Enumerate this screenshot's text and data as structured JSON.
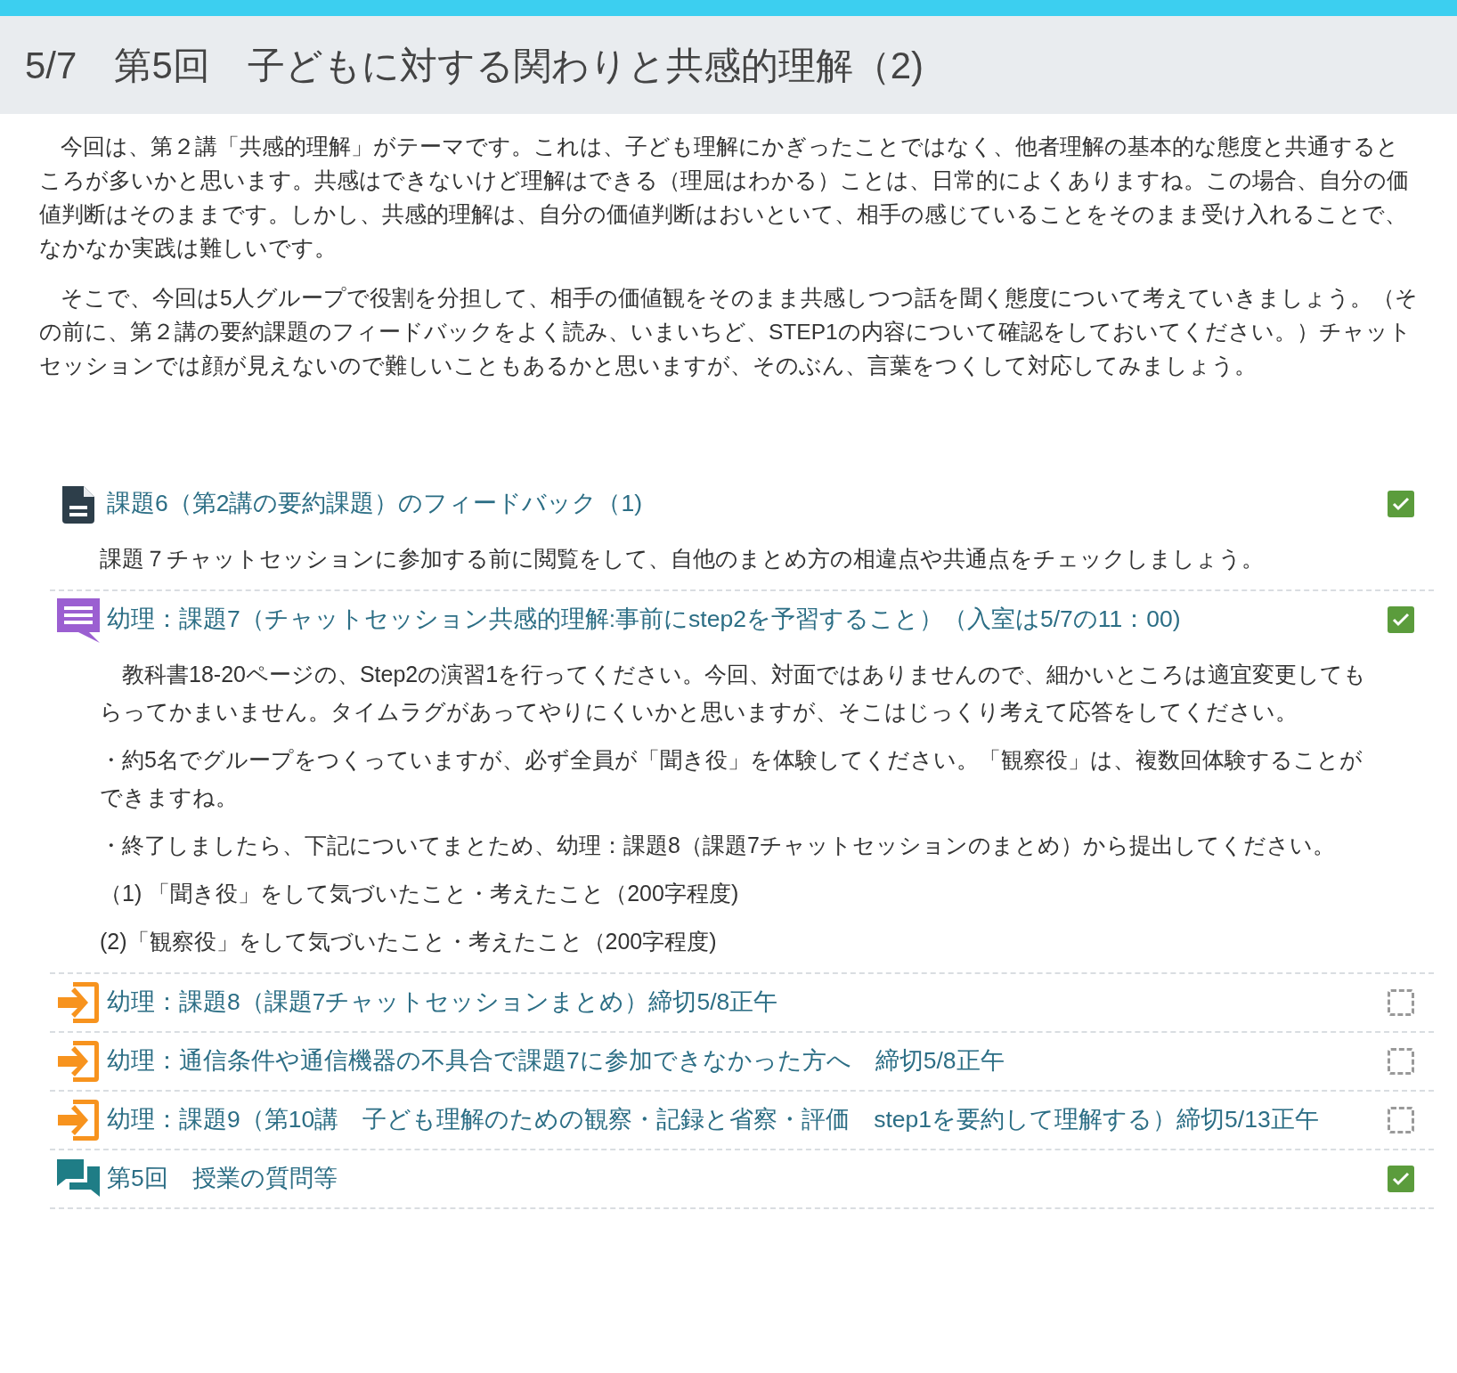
{
  "section": {
    "title": "5/7　第5回　子どもに対する関わりと共感的理解（2)",
    "summary": [
      "今回は、第２講「共感的理解」がテーマです。これは、子ども理解にかぎったことではなく、他者理解の基本的な態度と共通するところが多いかと思います。共感はできないけど理解はできる（理屈はわかる）ことは、日常的によくありますね。この場合、自分の価値判断はそのままです。しかし、共感的理解は、自分の価値判断はおいといて、相手の感じていることをそのまま受け入れることで、なかなか実践は難しいです。",
      "そこで、今回は5人グループで役割を分担して、相手の価値観をそのまま共感しつつ話を聞く態度について考えていきましょう。（その前に、第２講の要約課題のフィードバックをよく読み、いまいちど、STEP1の内容について確認をしておいてください。）チャットセッションでは顔が見えないので難しいこともあるかと思いますが、そのぶん、言葉をつくして対応してみましょう。"
    ]
  },
  "activities": [
    {
      "kind": "file",
      "title": "課題6（第2講の要約課題）のフィードバック（1)",
      "checked": true,
      "description": [
        "課題７チャットセッションに参加する前に閲覧をして、自他のまとめ方の相違点や共通点をチェックしましょう。"
      ]
    },
    {
      "kind": "chat",
      "title": "幼理：課題7（チャットセッション共感的理解:事前にstep2を予習すること）（入室は5/7の11：00)",
      "checked": true,
      "description": [
        "　教科書18-20ページの、Step2の演習1を行ってください。今回、対面ではありませんので、細かいところは適宜変更してもらってかまいません。タイムラグがあってやりにくいかと思いますが、そこはじっくり考えて応答をしてください。",
        "・約5名でグループをつくっていますが、必ず全員が「聞き役」を体験してください。「観察役」は、複数回体験することができますね。",
        "・終了しましたら、下記についてまとため、幼理：課題8（課題7チャットセッションのまとめ）から提出してください。",
        "（1) 「聞き役」をして気づいたこと・考えたこと（200字程度)",
        "(2)「観察役」をして気づいたこと・考えたこと（200字程度)"
      ]
    },
    {
      "kind": "assign",
      "title": "幼理：課題8（課題7チャットセッションまとめ）締切5/8正午",
      "checked": false
    },
    {
      "kind": "assign",
      "title": "幼理：通信条件や通信機器の不具合で課題7に参加できなかった方へ　締切5/8正午",
      "checked": false
    },
    {
      "kind": "assign",
      "title": "幼理：課題9（第10講　子ども理解のための観察・記録と省察・評価　step1を要約して理解する）締切5/13正午",
      "checked": false
    },
    {
      "kind": "forum",
      "title": "第5回　授業の質問等",
      "checked": true
    }
  ]
}
